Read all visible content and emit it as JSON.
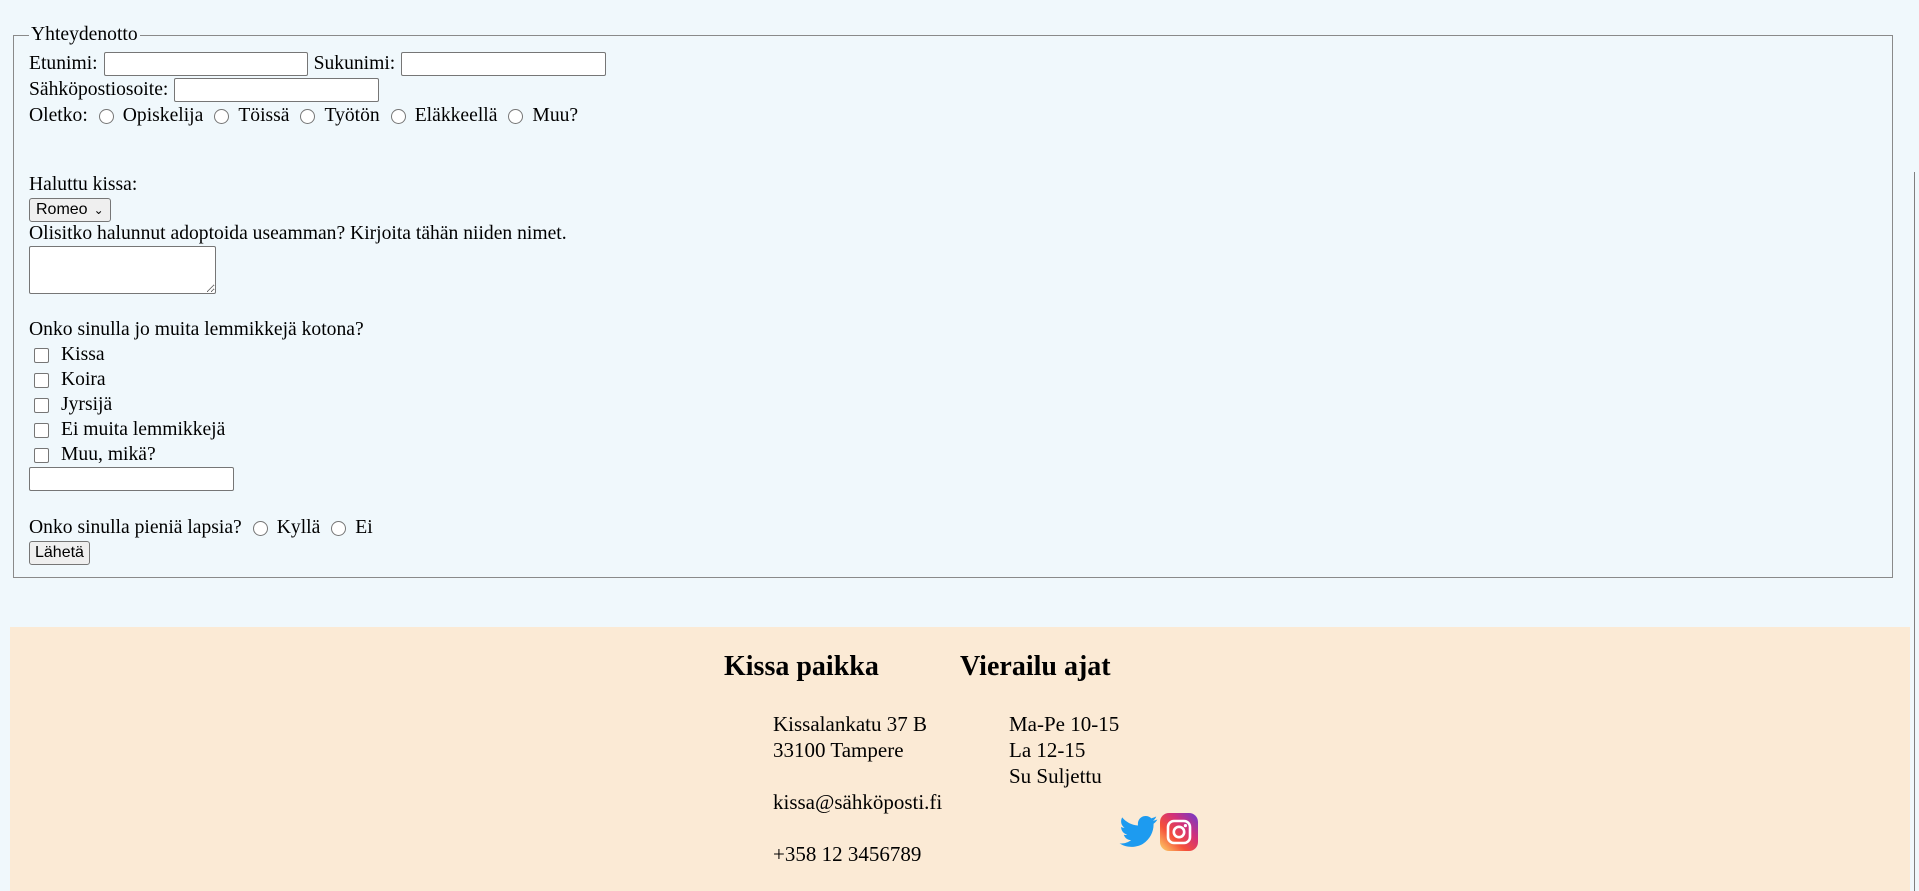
{
  "form": {
    "legend": "Yhteydenotto",
    "first_name_label": "Etunimi:",
    "last_name_label": "Sukunimi:",
    "email_label": "Sähköpostiosoite:",
    "status_label": "Oletko:",
    "status_options": [
      "Opiskelija",
      "Töissä",
      "Työtön",
      "Eläkkeellä",
      "Muu?"
    ],
    "cat_label": "Haluttu kissa:",
    "cat_selected": "Romeo",
    "more_cats_label": "Olisitko halunnut adoptoida useamman? Kirjoita tähän niiden nimet.",
    "pets_label": "Onko sinulla jo muita lemmikkejä kotona?",
    "pets_options": [
      "Kissa",
      "Koira",
      "Jyrsijä",
      "Ei muita lemmikkejä",
      "Muu, mikä?"
    ],
    "kids_label": "Onko sinulla pieniä lapsia?",
    "kids_options": [
      "Kyllä",
      "Ei"
    ],
    "submit_label": "Lähetä"
  },
  "footer": {
    "place_title": "Kissa paikka",
    "hours_title": "Vierailu ajat",
    "address_line1": "Kissalankatu 37 B",
    "address_line2": "33100 Tampere",
    "email": "kissa@sähköposti.fi",
    "phone": "+358 12 3456789",
    "hours": [
      "Ma-Pe 10-15",
      "La 12-15",
      "Su Suljettu"
    ],
    "social_icons": [
      "twitter-icon",
      "instagram-icon"
    ]
  }
}
